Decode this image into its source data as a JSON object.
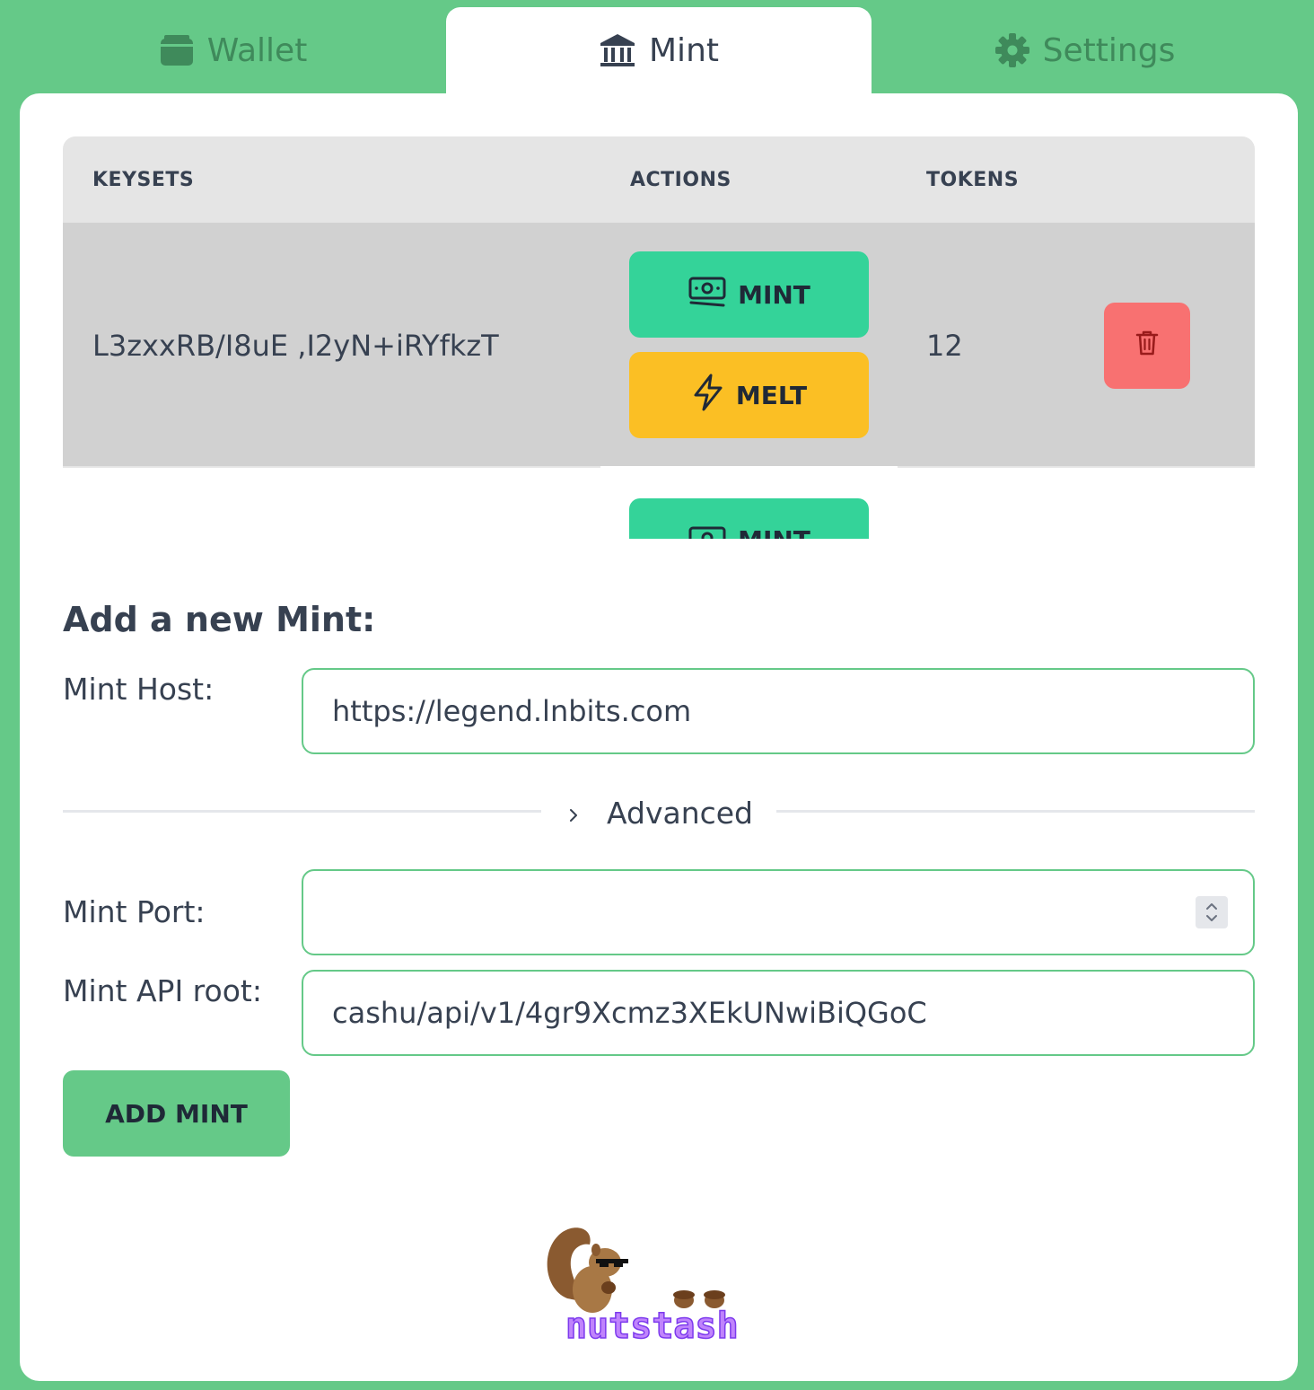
{
  "tabs": {
    "wallet": "Wallet",
    "mint": "Mint",
    "settings": "Settings",
    "active": "mint"
  },
  "table": {
    "headers": [
      "KEYSETS",
      "ACTIONS",
      "TOKENS"
    ],
    "rows": [
      {
        "keysets": "L3zxxRB/I8uE ,I2yN+iRYfkzT",
        "mint_label": "MINT",
        "melt_label": "MELT",
        "tokens": "12"
      },
      {
        "mint_label": "MINT"
      }
    ]
  },
  "form": {
    "title": "Add a new Mint:",
    "host_label": "Mint Host:",
    "host_value": "https://legend.lnbits.com",
    "advanced_label": "Advanced",
    "port_label": "Mint Port:",
    "port_value": "",
    "api_root_label": "Mint API root:",
    "api_root_value": "cashu/api/v1/4gr9Xcmz3XEkUNwiBiQGoC",
    "add_button": "ADD MINT"
  },
  "logo": {
    "text": "nutstash"
  },
  "colors": {
    "background": "#65c988",
    "mint_button": "#34d399",
    "melt_button": "#fbbf24",
    "delete_button": "#f87171",
    "input_border": "#65c988"
  },
  "icons": [
    "wallet-icon",
    "bank-icon",
    "gear-icon",
    "cash-icon",
    "lightning-icon",
    "trash-icon",
    "chevron-right-icon",
    "spinner-icon"
  ]
}
